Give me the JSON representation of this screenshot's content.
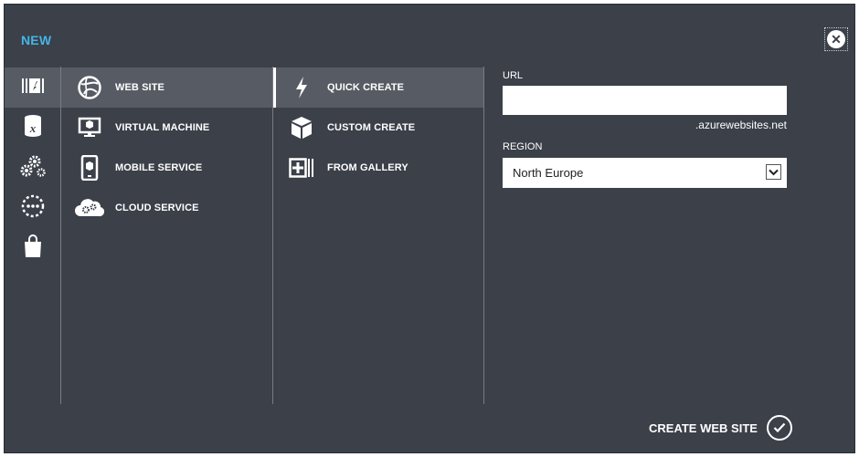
{
  "dialog": {
    "title": "NEW",
    "close_icon": "close-icon"
  },
  "categories": [
    {
      "name": "compute-icon",
      "selected": true
    },
    {
      "name": "data-services-icon",
      "selected": false
    },
    {
      "name": "app-services-icon",
      "selected": false
    },
    {
      "name": "network-services-icon",
      "selected": false
    },
    {
      "name": "store-icon",
      "selected": false
    }
  ],
  "services": [
    {
      "label": "WEB SITE",
      "icon": "globe-icon",
      "selected": true
    },
    {
      "label": "VIRTUAL MACHINE",
      "icon": "monitor-icon",
      "selected": false
    },
    {
      "label": "MOBILE SERVICE",
      "icon": "mobile-icon",
      "selected": false
    },
    {
      "label": "CLOUD SERVICE",
      "icon": "cloud-gears-icon",
      "selected": false
    }
  ],
  "options": [
    {
      "label": "QUICK CREATE",
      "icon": "lightning-icon",
      "selected": true
    },
    {
      "label": "CUSTOM CREATE",
      "icon": "box-icon",
      "selected": false
    },
    {
      "label": "FROM GALLERY",
      "icon": "gallery-icon",
      "selected": false
    }
  ],
  "form": {
    "url_label": "URL",
    "url_value": "",
    "url_suffix": ".azurewebsites.net",
    "region_label": "REGION",
    "region_value": "North Europe"
  },
  "footer": {
    "create_label": "CREATE WEB SITE"
  },
  "colors": {
    "background": "#3b4049",
    "selected": "#575c64",
    "accent": "#46b4e8"
  }
}
